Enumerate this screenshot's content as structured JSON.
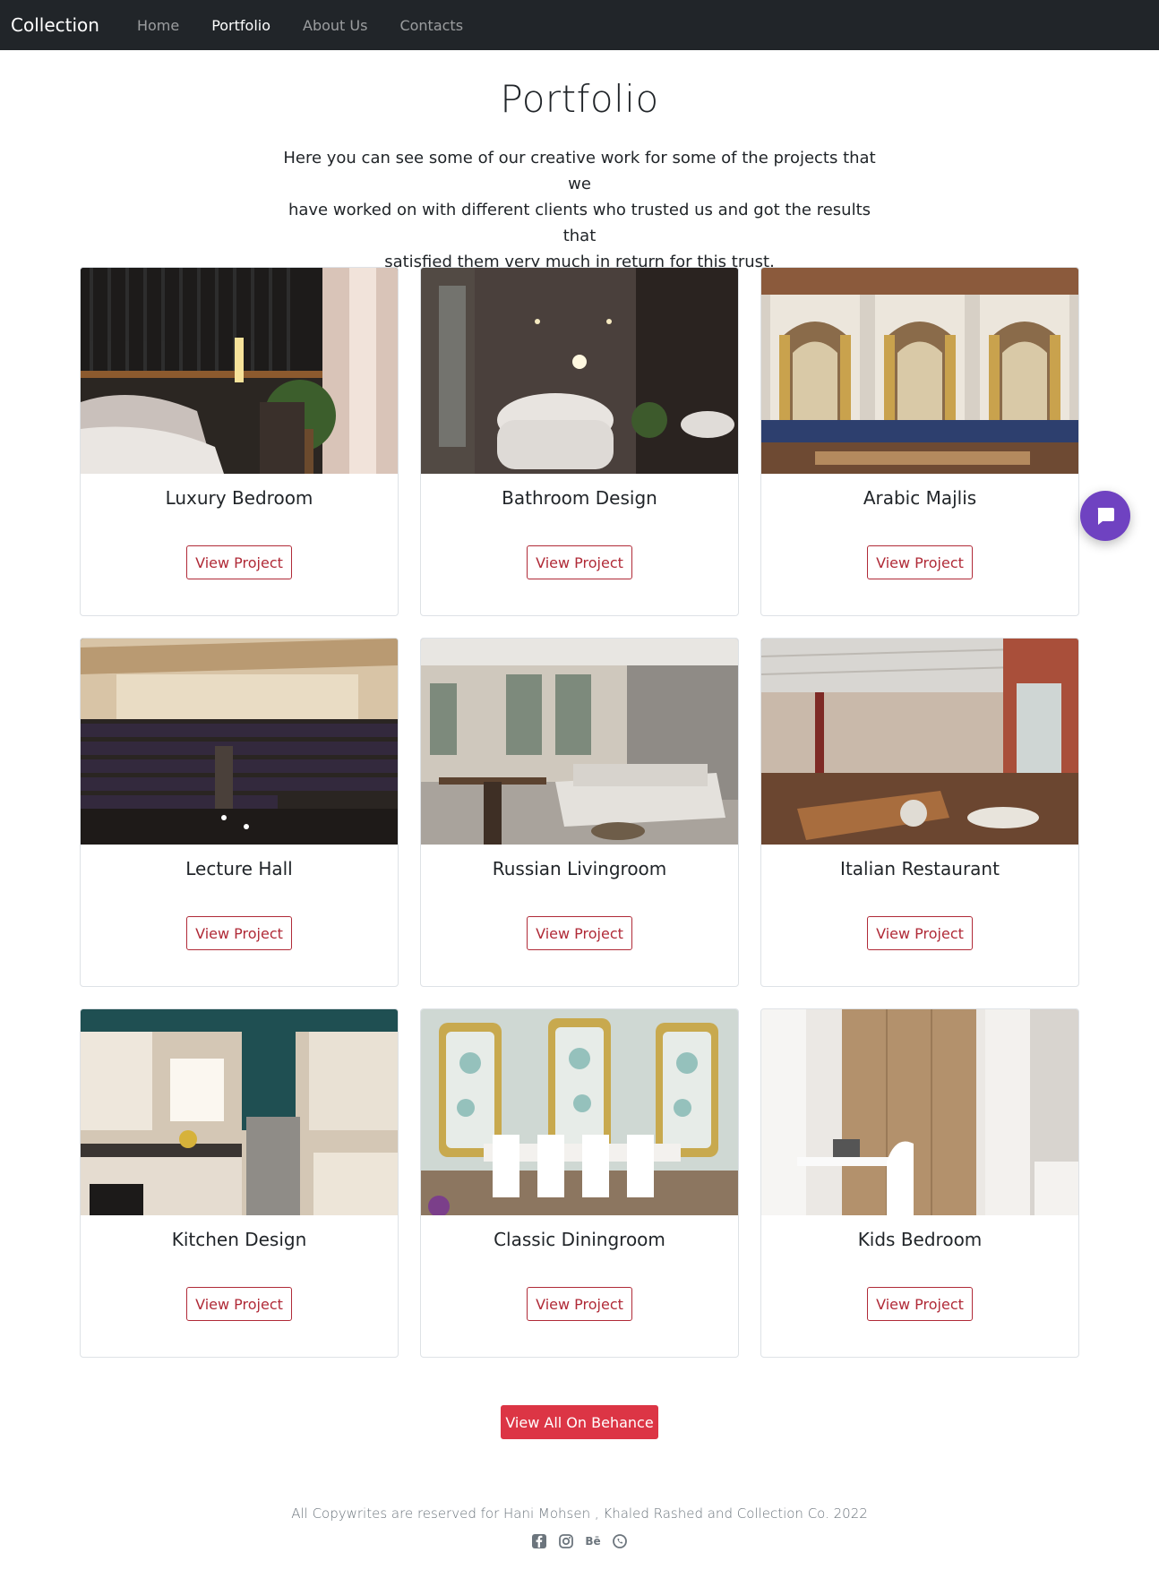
{
  "nav": {
    "brand": "Collection",
    "items": [
      {
        "label": "Home",
        "active": false
      },
      {
        "label": "Portfolio",
        "active": true
      },
      {
        "label": "About Us",
        "active": false
      },
      {
        "label": "Contacts",
        "active": false
      }
    ]
  },
  "header": {
    "title": "Portfolio",
    "lead_lines": [
      "Here you can see some of our creative work for some of the projects that we",
      "have worked on with different clients who trusted us and got the results that",
      "satisfied them very much in return for this trust."
    ]
  },
  "projects": [
    {
      "title": "Luxury Bedroom",
      "button": "View Project"
    },
    {
      "title": "Bathroom Design",
      "button": "View Project"
    },
    {
      "title": "Arabic Majlis",
      "button": "View Project"
    },
    {
      "title": "Lecture Hall",
      "button": "View Project"
    },
    {
      "title": "Russian Livingroom",
      "button": "View Project"
    },
    {
      "title": "Italian Restaurant",
      "button": "View Project"
    },
    {
      "title": "Kitchen Design",
      "button": "View Project"
    },
    {
      "title": "Classic Diningroom",
      "button": "View Project"
    },
    {
      "title": "Kids Bedroom",
      "button": "View Project"
    }
  ],
  "cta": {
    "label": "View All On Behance"
  },
  "footer": {
    "copyright": "All Copywrites are reserved for Hani Mohsen , Khaled Rashed and Collection Co. 2022",
    "socials": [
      "facebook-icon",
      "instagram-icon",
      "behance-icon",
      "whatsapp-icon"
    ],
    "behance_glyph": "Bē"
  },
  "colors": {
    "navbar": "#212529",
    "accent_outline": "#b02a37",
    "cta": "#dc3545",
    "chat": "#6f42c1"
  }
}
